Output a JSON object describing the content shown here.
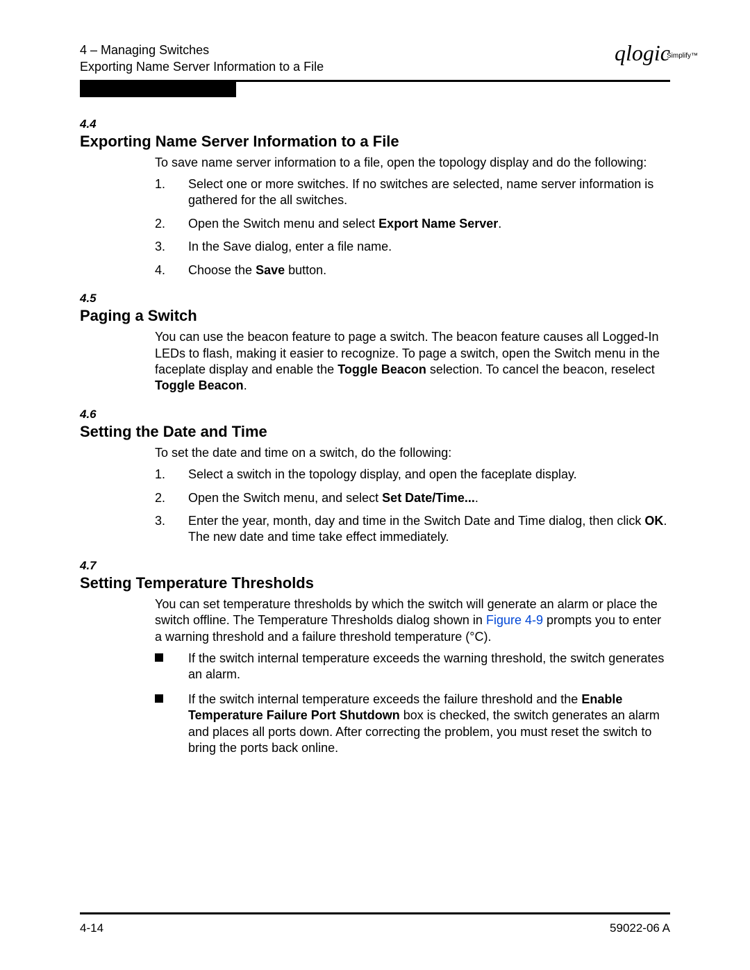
{
  "header": {
    "chapter_line": "4 – Managing Switches",
    "subtitle": "Exporting Name Server Information to a File",
    "logo_text": "qlogic",
    "logo_sub": "Simplify™"
  },
  "sections": {
    "s44": {
      "num": "4.4",
      "title": "Exporting Name Server Information to a File",
      "intro": "To save name server information to a file, open the topology display and do the following:",
      "steps": {
        "n1": "1.",
        "t1": "Select one or more switches. If no switches are selected, name server information is gathered for the all switches.",
        "n2": "2.",
        "t2a": "Open the Switch menu and select ",
        "t2b": "Export Name Server",
        "t2c": ".",
        "n3": "3.",
        "t3": "In the Save dialog, enter a file name.",
        "n4": "4.",
        "t4a": "Choose the ",
        "t4b": "Save",
        "t4c": " button."
      }
    },
    "s45": {
      "num": "4.5",
      "title": "Paging a Switch",
      "p1a": "You can use the beacon feature to page a switch. The beacon feature causes all Logged-In LEDs to flash, making it easier to recognize. To page a switch, open the Switch menu in the faceplate display and enable the ",
      "p1b": "Toggle Beacon",
      "p1c": " selection. To cancel the beacon, reselect ",
      "p1d": "Toggle Beacon",
      "p1e": "."
    },
    "s46": {
      "num": "4.6",
      "title": "Setting the Date and Time",
      "intro": "To set the date and time on a switch, do the following:",
      "steps": {
        "n1": "1.",
        "t1": "Select a switch in the topology display, and open the faceplate display.",
        "n2": "2.",
        "t2a": "Open the Switch menu, and select ",
        "t2b": "Set Date/Time...",
        "t2c": ".",
        "n3": "3.",
        "t3a": "Enter the year, month, day and time in the Switch Date and Time dialog, then click ",
        "t3b": "OK",
        "t3c": ". The new date and time take effect immediately."
      }
    },
    "s47": {
      "num": "4.7",
      "title": "Setting Temperature Thresholds",
      "p1a": "You can set temperature thresholds by which the switch will generate an alarm or place the switch offline. The Temperature Thresholds dialog shown in ",
      "p1link": "Figure 4-9",
      "p1b": " prompts you to enter a warning threshold and a failure threshold temperature (°C).",
      "b1": "If the switch internal temperature exceeds the warning threshold, the switch generates an alarm.",
      "b2a": "If the switch internal temperature exceeds the failure threshold and the ",
      "b2b": "Enable Temperature Failure Port Shutdown",
      "b2c": " box is checked, the switch generates an alarm and places all ports down. After correcting the problem, you must reset the switch to bring the ports back online."
    }
  },
  "footer": {
    "page": "4-14",
    "doc": "59022-06  A"
  }
}
